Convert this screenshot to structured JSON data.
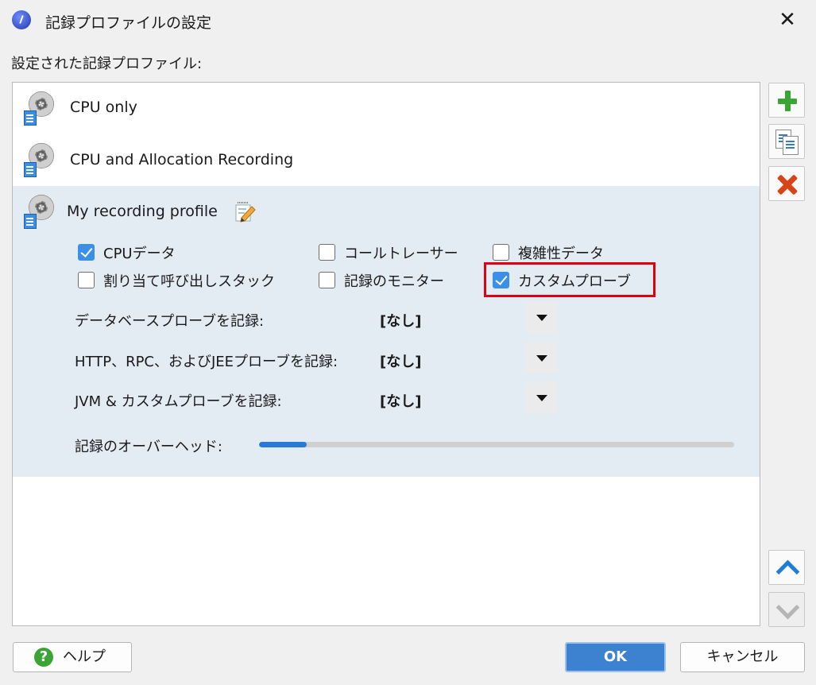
{
  "window": {
    "title": "記録プロファイルの設定",
    "close_glyph": "✕"
  },
  "list_label": "設定された記録プロファイル:",
  "profiles": [
    {
      "name": "CPU only"
    },
    {
      "name": "CPU and Allocation Recording"
    },
    {
      "name": "My recording profile"
    }
  ],
  "options": {
    "cpu_data": {
      "label": "CPUデータ",
      "checked": true
    },
    "call_tracer": {
      "label": "コールトレーサー",
      "checked": false
    },
    "complexity": {
      "label": "複雑性データ",
      "checked": false
    },
    "alloc_stacks": {
      "label": "割り当て呼び出しスタック",
      "checked": false
    },
    "monitor": {
      "label": "記録のモニター",
      "checked": false
    },
    "custom_probes": {
      "label": "カスタムプローブ",
      "checked": true
    }
  },
  "probe_rows": [
    {
      "label": "データベースプローブを記録:",
      "value": "[なし]"
    },
    {
      "label": "HTTP、RPC、およびJEEプローブを記録:",
      "value": "[なし]"
    },
    {
      "label": "JVM & カスタムプローブを記録:",
      "value": "[なし]"
    }
  ],
  "overhead": {
    "label": "記録のオーバーヘッド:",
    "fraction": 0.1
  },
  "side_buttons": [
    "add-icon",
    "copy-icon",
    "delete-icon",
    "move-up-icon",
    "move-down-icon"
  ],
  "buttons": {
    "help": "ヘルプ",
    "help_glyph": "?",
    "ok": "OK",
    "cancel": "キャンセル"
  },
  "colors": {
    "accent": "#3c82d1",
    "check": "#3c8fe6",
    "selected_row": "#e3ebf3",
    "highlight": "#e0000f"
  }
}
